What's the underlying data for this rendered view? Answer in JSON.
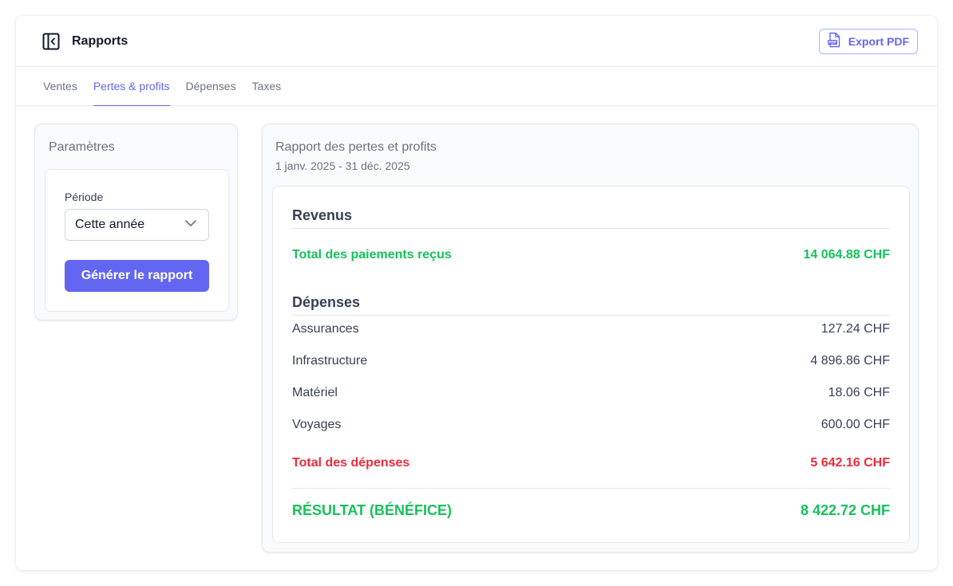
{
  "header": {
    "title": "Rapports",
    "export_label": "Export PDF",
    "sidebar_icon": "sidebar-collapse-icon",
    "export_icon": "pdf-file-icon"
  },
  "tabs": [
    {
      "label": "Ventes",
      "active": false
    },
    {
      "label": "Pertes & profits",
      "active": true
    },
    {
      "label": "Dépenses",
      "active": false
    },
    {
      "label": "Taxes",
      "active": false
    }
  ],
  "params": {
    "title": "Paramètres",
    "period_label": "Période",
    "period_value": "Cette année",
    "generate_label": "Générer le rapport"
  },
  "report": {
    "title": "Rapport des pertes et profits",
    "dates": "1 janv. 2025 - 31 déc. 2025",
    "revenue": {
      "heading": "Revenus",
      "total_label": "Total des paiements reçus",
      "total_value": "14 064.88 CHF"
    },
    "expenses": {
      "heading": "Dépenses",
      "items": [
        {
          "label": "Assurances",
          "value": "127.24 CHF"
        },
        {
          "label": "Infrastructure",
          "value": "4 896.86 CHF"
        },
        {
          "label": "Matériel",
          "value": "18.06 CHF"
        },
        {
          "label": "Voyages",
          "value": "600.00 CHF"
        }
      ],
      "total_label": "Total des dépenses",
      "total_value": "5 642.16 CHF"
    },
    "result": {
      "label": "RÉSULTAT (BÉNÉFICE)",
      "value": "8 422.72 CHF"
    }
  },
  "colors": {
    "accent": "#6366f1",
    "positive": "#16c15a",
    "negative": "#ef2b3c"
  }
}
